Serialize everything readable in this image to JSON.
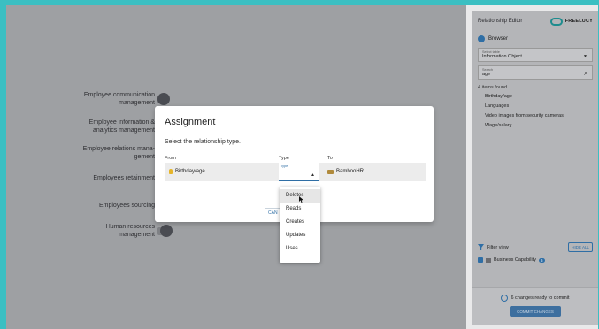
{
  "canvas": {
    "nodes": [
      {
        "label": "Employee communication management"
      },
      {
        "label": "Employee information & analytics management"
      },
      {
        "label": "Employee relations mana- gement"
      },
      {
        "label": "Employees retainment"
      },
      {
        "label": "Employees sourcing"
      },
      {
        "label": "Human resources management"
      }
    ]
  },
  "panel": {
    "title": "Relationship Editor",
    "logo": "FREELUCY",
    "browser_label": "Browser",
    "select": {
      "label": "Select table",
      "value": "Information Object"
    },
    "search": {
      "label": "Search",
      "value": "age"
    },
    "found_text": "4 items found",
    "results": [
      "Birthday/age",
      "Languages",
      "Video images from security cameras",
      "Wage/salary"
    ],
    "filter_label": "Filter view",
    "hide_all_label": "HIDE ALL",
    "filter_item": {
      "label": "Business Capability",
      "count": "6"
    },
    "commit_status": "6 changes ready to commit",
    "commit_button": "COMMIT CHANGES"
  },
  "modal": {
    "title": "Assignment",
    "subtitle": "Select the relationship type.",
    "columns": {
      "from": "From",
      "type": "Type",
      "to": "To"
    },
    "row": {
      "from": "Birthday/age",
      "type_label": "Type",
      "to": "BambooHR"
    },
    "cancel_label": "CAN"
  },
  "dropdown": {
    "options": [
      "Deletes",
      "Reads",
      "Creates",
      "Updates",
      "Uses"
    ]
  },
  "colors": {
    "accent": "#3bbfc2",
    "primary": "#2f6ea5"
  }
}
